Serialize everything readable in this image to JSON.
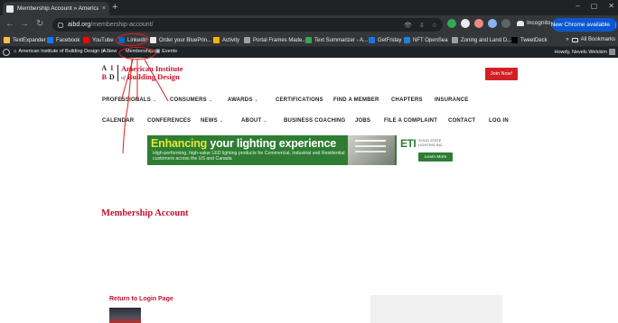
{
  "browser": {
    "tab": {
      "title": "Membership Account » American",
      "close": "×"
    },
    "new_tab": "+",
    "window_controls": [
      "–",
      "▢",
      "✕"
    ],
    "nav": {
      "back": "←",
      "forward": "→",
      "reload": "↻"
    },
    "url": {
      "host": "aibd.org",
      "path": "/membership-account/"
    },
    "omnibox_icons": [
      "👁",
      "⇩",
      "☆"
    ],
    "incognito_label": "Incognito",
    "update_button": "New Chrome available",
    "update_menu": "⋮"
  },
  "bookmarks": {
    "items": [
      {
        "label": "TextExpander",
        "color": "#f6c243"
      },
      {
        "label": "Facebook",
        "color": "#1877f2"
      },
      {
        "label": "YouTube",
        "color": "#ff0000"
      },
      {
        "label": "LinkedIn",
        "color": "#0a66c2"
      },
      {
        "label": "Order your BluePrin...",
        "color": "#e8eaed"
      },
      {
        "label": "Activity",
        "color": "#ffb300"
      },
      {
        "label": "Portal Frames Made...",
        "color": "#9aa0a6"
      },
      {
        "label": "Text Summarizer - A...",
        "color": "#34a853"
      },
      {
        "label": "GetFriday",
        "color": "#1a73e8"
      },
      {
        "label": "NFT OpenSea",
        "color": "#2081e2"
      },
      {
        "label": "Zoning and Land D...",
        "color": "#9aa0a6"
      },
      {
        "label": "TweetDeck",
        "color": "#000000"
      }
    ],
    "all_bookmarks": "All Bookmarks",
    "more": "»"
  },
  "admin_bar": {
    "site_name": "American Institute of Building Design (A...",
    "new_label": "New",
    "memberships_label": "Memberships",
    "events_label": "Events",
    "howdy": "Howdy, Nevels Welckim"
  },
  "site": {
    "logo": {
      "letters": [
        "A",
        "I",
        "B",
        "D"
      ],
      "line1": "American Institute",
      "line2_prefix": "of",
      "line2": "Building Design"
    },
    "join_button": "Join Now!",
    "menu_row1": [
      {
        "label": "PROFESSIONALS",
        "caret": "⌄"
      },
      {
        "label": "CONSUMERS",
        "caret": "⌄"
      },
      {
        "label": "AWARDS",
        "caret": "⌄"
      },
      {
        "label": "CERTIFICATIONS",
        "caret": ""
      },
      {
        "label": "FIND A MEMBER",
        "caret": ""
      },
      {
        "label": "CHAPTERS",
        "caret": ""
      },
      {
        "label": "INSURANCE",
        "caret": ""
      }
    ],
    "menu_row2": [
      {
        "label": "CALENDAR",
        "caret": ""
      },
      {
        "label": "CONFERENCES",
        "caret": ""
      },
      {
        "label": "NEWS",
        "caret": "⌄"
      },
      {
        "label": "ABOUT",
        "caret": "⌄"
      },
      {
        "label": "BUSINESS COACHING",
        "caret": ""
      },
      {
        "label": "JOBS",
        "caret": ""
      },
      {
        "label": "FILE A COMPLAINT",
        "caret": ""
      },
      {
        "label": "CONTACT",
        "caret": ""
      },
      {
        "label": "LOG IN",
        "caret": ""
      }
    ]
  },
  "banner": {
    "headline_highlight": "Enhancing",
    "headline_rest": " your lighting experience",
    "sub": "High-performing, high-value LED lighting products for Commercial, Industrial and Residential customers across the US and Canada",
    "brand": "ETI",
    "brand_sub": "SOLID STATE LIGHTING INC.",
    "cta": "Learn More"
  },
  "page": {
    "title": "Membership Account",
    "return_link": "Return to Login Page"
  },
  "colors": {
    "brand_red": "#c8102e",
    "join_red": "#d32027",
    "banner_green": "#2e7d33",
    "chrome_dark": "#202124",
    "annotation_red": "#d4231c"
  }
}
